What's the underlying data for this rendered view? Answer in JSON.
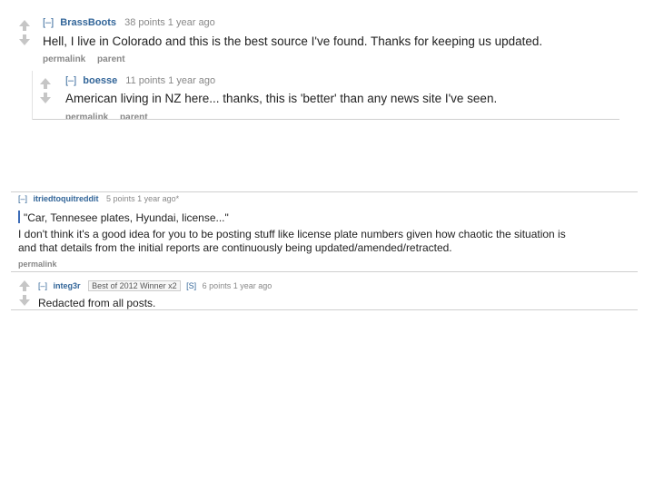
{
  "thread1": {
    "comment1": {
      "toggle": "[–]",
      "author": "BrassBoots",
      "meta": "38 points 1 year ago",
      "body": "Hell, I live in Colorado and this is the best source I've found. Thanks for keeping us updated.",
      "buttons": [
        "permalink",
        "parent"
      ]
    },
    "comment2": {
      "toggle": "[–]",
      "author": "boesse",
      "meta": "11 points 1 year ago",
      "body": "American living in NZ here... thanks, this is 'better' than any news site I've seen.",
      "buttons": [
        "permalink",
        "parent"
      ]
    }
  },
  "thread2": {
    "comment1": {
      "toggle": "[–]",
      "author": "itriedtoquitreddit",
      "meta": "5 points 1 year ago*",
      "quote": "\"Car, Tennesee plates, Hyundai, license...\"",
      "body_line1": "I don't think it's a good idea for you to be posting stuff like license plate numbers given how chaotic the situation is",
      "body_line2": "and that details from the initial reports are continuously being updated/amended/retracted.",
      "buttons": [
        "permalink"
      ]
    },
    "comment2": {
      "toggle": "[–]",
      "author": "integ3r",
      "flair": "Best of 2012 Winner x2",
      "tag": "[S]",
      "meta": "6 points 1 year ago",
      "body": "Redacted from all posts."
    }
  }
}
